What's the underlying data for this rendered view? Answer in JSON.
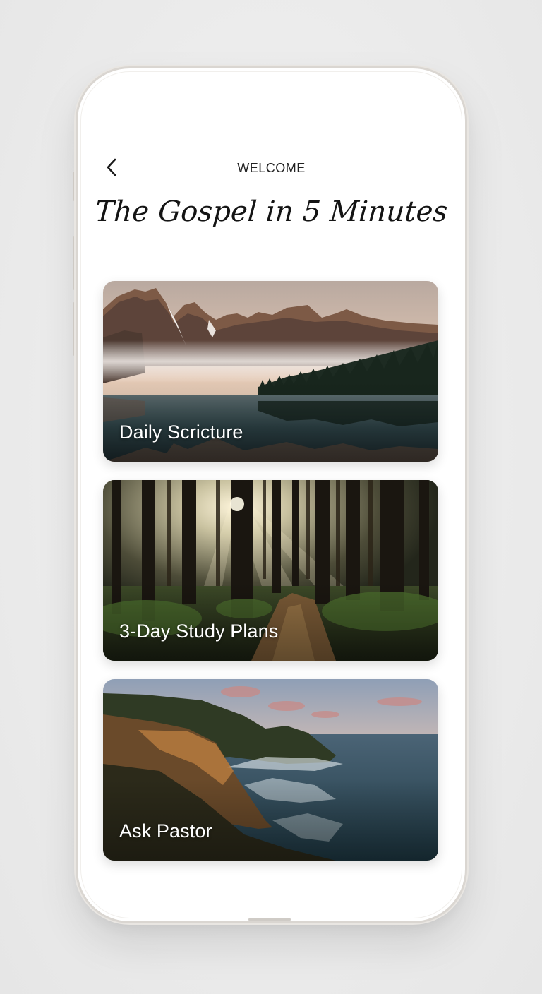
{
  "header": {
    "back_icon": "chevron-left-icon",
    "title": "WELCOME"
  },
  "app": {
    "title": "The Gospel in 5 Minutes"
  },
  "cards": [
    {
      "label": "Daily Scricture",
      "image": "mountain-lake-photo"
    },
    {
      "label": "3-Day Study Plans",
      "image": "forest-path-photo"
    },
    {
      "label": "Ask Pastor",
      "image": "coastal-cliff-photo"
    }
  ],
  "colors": {
    "background": "#ececec",
    "screen": "#ffffff",
    "text": "#141414",
    "card_label": "#ffffff"
  }
}
